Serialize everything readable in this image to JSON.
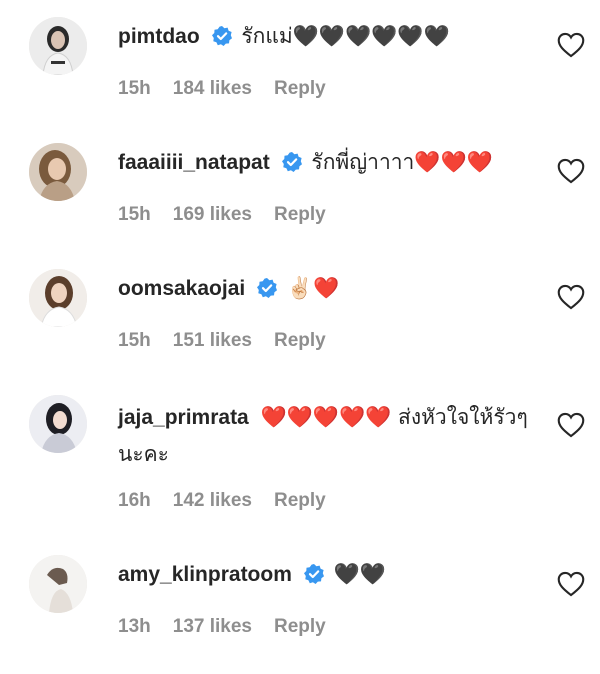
{
  "comments": [
    {
      "username": "pimtdao",
      "verified": true,
      "text": "รักแม่🖤🖤🖤🖤🖤🖤",
      "time": "15h",
      "likes": "184 likes",
      "reply": "Reply"
    },
    {
      "username": "faaaiiii_natapat",
      "verified": true,
      "text": "รักพี่ญ่าาาา❤️❤️❤️",
      "time": "15h",
      "likes": "169 likes",
      "reply": "Reply"
    },
    {
      "username": "oomsakaojai",
      "verified": true,
      "text": "✌🏻❤️",
      "time": "15h",
      "likes": "151 likes",
      "reply": "Reply"
    },
    {
      "username": "jaja_primrata",
      "verified": false,
      "text": "❤️❤️❤️❤️❤️ ส่งหัวใจให้รัวๆนะคะ",
      "time": "16h",
      "likes": "142 likes",
      "reply": "Reply"
    },
    {
      "username": "amy_klinpratoom",
      "verified": true,
      "text": "🖤🖤",
      "time": "13h",
      "likes": "137 likes",
      "reply": "Reply"
    }
  ],
  "colors": {
    "verified_blue": "#3897f0",
    "meta_gray": "#8e8e8e",
    "heart_red": "#ed1c24",
    "text": "#262626"
  },
  "icons": {
    "verified": "verified-badge-icon",
    "like": "heart-outline-icon"
  }
}
